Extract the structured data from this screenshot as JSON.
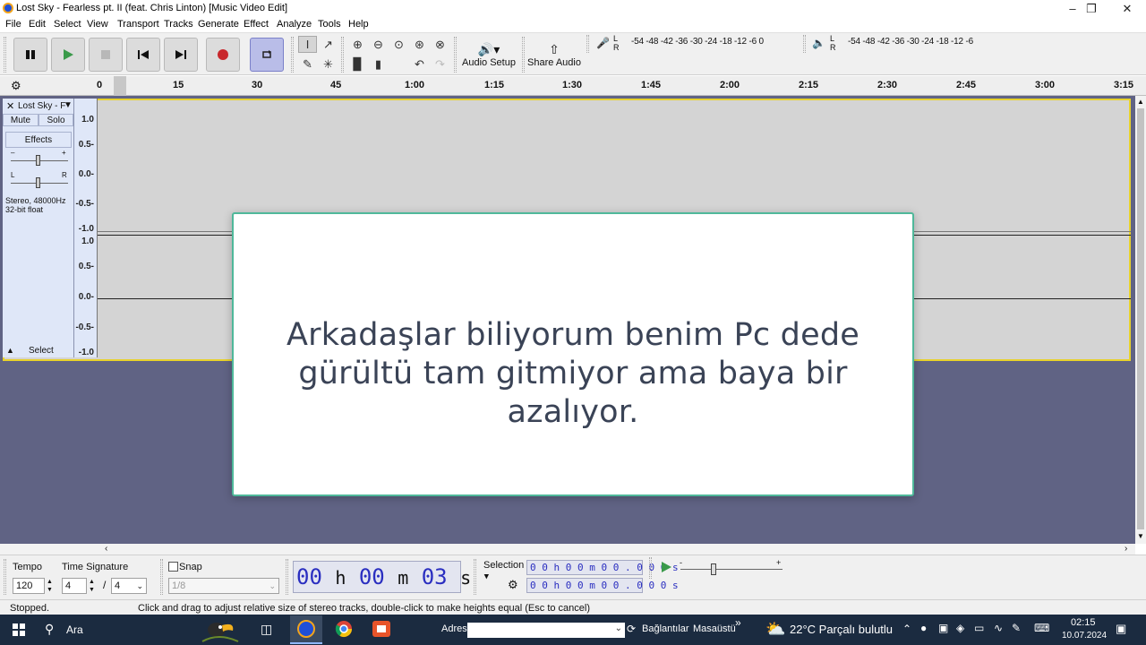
{
  "window": {
    "title": "Lost Sky - Fearless pt. II (feat. Chris Linton) [Music Video Edit]",
    "controls": [
      "minimize",
      "maximize",
      "close"
    ]
  },
  "menu": [
    "File",
    "Edit",
    "Select",
    "View",
    "Transport",
    "Tracks",
    "Generate",
    "Effect",
    "Analyze",
    "Tools",
    "Help"
  ],
  "toolbar": {
    "audio_setup_label": "Audio Setup",
    "share_audio_label": "Share Audio",
    "record_meter": {
      "channels": [
        "L",
        "R"
      ],
      "ticks": "-54 -48 -42 -36 -30 -24 -18 -12 -6 0"
    },
    "playback_meter": {
      "channels": [
        "L",
        "R"
      ],
      "ticks": "-54 -48 -42 -36 -30 -24 -18 -12 -6"
    }
  },
  "timeline": {
    "labels": [
      "0",
      "15",
      "30",
      "45",
      "1:00",
      "1:15",
      "1:30",
      "1:45",
      "2:00",
      "2:15",
      "2:30",
      "2:45",
      "3:00",
      "3:15"
    ]
  },
  "track": {
    "name": "Lost Sky - F",
    "mute_label": "Mute",
    "solo_label": "Solo",
    "effects_label": "Effects",
    "gain_minus": "–",
    "gain_plus": "+",
    "pan_left": "L",
    "pan_right": "R",
    "info_line1": "Stereo, 48000Hz",
    "info_line2": "32-bit float",
    "select_label": "Select",
    "vruler_labels": [
      "1.0",
      "0.5-",
      "0.0-",
      "-0.5-",
      "-1.0"
    ]
  },
  "overlay": {
    "line1": "Arkadaşlar biliyorum benim Pc dede",
    "line2": "gürültü tam gitmiyor ama baya bir azalıyor."
  },
  "bottom": {
    "tempo_label": "Tempo",
    "tempo_value": "120",
    "time_signature_label": "Time Signature",
    "ts_numerator": "4",
    "ts_separator": "/",
    "ts_denominator": "4",
    "snap_label": "Snap",
    "snap_value": "1/8",
    "time_h": "00",
    "time_h_unit": "h",
    "time_m": "00",
    "time_m_unit": "m",
    "time_s": "03",
    "time_s_unit": "s",
    "selection_label": "Selection",
    "selection_start": "0 0 h 0 0 m 0 0 . 0 0 0 s",
    "selection_end": "0 0 h 0 0 m 0 0 . 0 0 0 s",
    "speed_minus": "-",
    "speed_plus": "+"
  },
  "status": {
    "state": "Stopped.",
    "hint": "Click and drag to adjust relative size of stereo tracks, double-click to make heights equal (Esc to cancel)"
  },
  "taskbar": {
    "search_label": "Ara",
    "address_label": "Adres",
    "links_label": "Bağlantılar",
    "desktop_label": "Masaüstü",
    "chevron": "»",
    "weather": "22°C  Parçalı bulutlu",
    "time": "02:15",
    "date": "10.07.2024"
  },
  "colors": {
    "accent_loop": "#b9bde8",
    "record_red": "#c8282c",
    "play_green": "#3a9a4a",
    "track_border": "#e8d22c",
    "overlay_border": "#4fb89a",
    "time_display": "#2a2ec0",
    "taskbar_bg": "#1b2b40"
  }
}
